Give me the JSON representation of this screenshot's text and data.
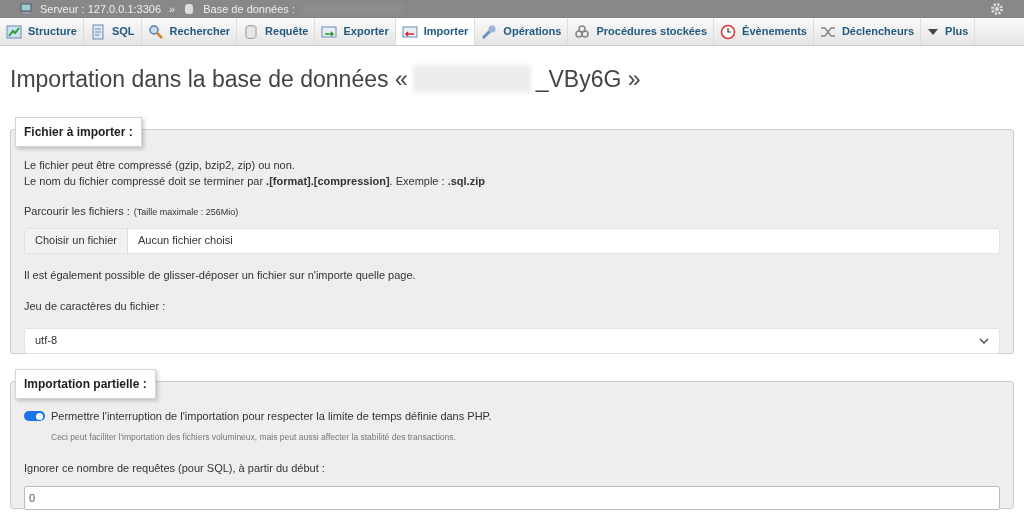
{
  "breadcrumb": {
    "server": "Serveur : 127.0.0.1:3306",
    "separator": "»",
    "database": "Base de données :"
  },
  "tabs": [
    {
      "label": "Structure",
      "selected": false
    },
    {
      "label": "SQL",
      "selected": false
    },
    {
      "label": "Rechercher",
      "selected": false
    },
    {
      "label": "Requête",
      "selected": false
    },
    {
      "label": "Exporter",
      "selected": false
    },
    {
      "label": "Importer",
      "selected": true
    },
    {
      "label": "Opérations",
      "selected": false
    },
    {
      "label": "Procédures stockées",
      "selected": false
    },
    {
      "label": "Évènements",
      "selected": false
    },
    {
      "label": "Déclencheurs",
      "selected": false
    },
    {
      "label": "Plus",
      "selected": false
    }
  ],
  "title": {
    "prefix": "Importation dans la base de données «",
    "suffix": "_VBy6G »"
  },
  "file_section": {
    "legend": "Fichier à importer :",
    "note_1": "Le fichier peut être compressé (gzip, bzip2, zip) ou non.",
    "note_2": "Le nom du fichier compressé doit se terminer par **.[format].[compression]**. Exemple : **.sql.zip**",
    "browse_label": "Parcourir les fichiers :",
    "max_size": "(Taille maximale : 256Mio)",
    "choose_button": "Choisir un fichier",
    "no_file": "Aucun fichier choisi",
    "drag_note": "Il est également possible de glisser-déposer un fichier sur n'importe quelle page.",
    "charset_label": "Jeu de caractères du fichier :",
    "charset_value": "utf-8"
  },
  "partial_section": {
    "legend": "Importation partielle :",
    "allow_interrupt": {
      "label": "Permettre l'interruption de l'importation pour respecter la limite de temps définie dans PHP.",
      "hint": "Ceci peut faciliter l'importation des fichiers volumineux, mais peut aussi affecter la stabilité des transactions.",
      "on": true
    },
    "skip_label": "Ignorer ce nombre de requêtes (pour SQL), à partir du début :",
    "skip_value": "0"
  }
}
